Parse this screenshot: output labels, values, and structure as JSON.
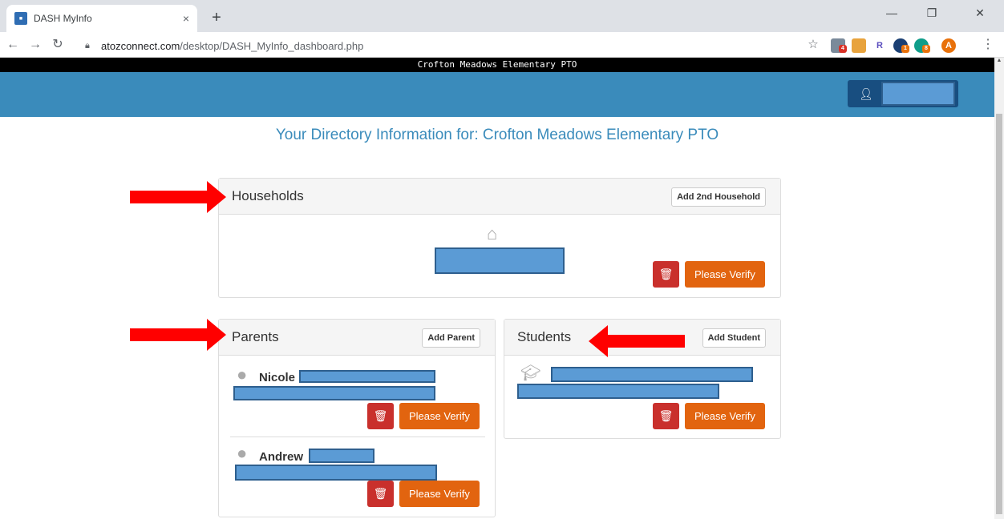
{
  "browser": {
    "tab_title": "DASH MyInfo",
    "tab_close": "×",
    "new_tab": "+",
    "url_host": "atozconnect.com",
    "url_path": "/desktop/DASH_MyInfo_dashboard.php",
    "ext_badges": [
      "4",
      "R",
      "1",
      "8",
      "A"
    ]
  },
  "site": {
    "banner": "Crofton Meadows Elementary PTO"
  },
  "page": {
    "title": "Your Directory Information for: Crofton Meadows Elementary PTO"
  },
  "households": {
    "heading": "Households",
    "add_label": "Add 2nd Household",
    "verify_label": "Please Verify"
  },
  "parents": {
    "heading": "Parents",
    "add_label": "Add  Parent",
    "items": [
      {
        "first_name": "Nicole",
        "verify_label": "Please Verify"
      },
      {
        "first_name": "Andrew",
        "verify_label": "Please Verify"
      }
    ]
  },
  "students": {
    "heading": "Students",
    "add_label": "Add Student",
    "verify_label": "Please Verify"
  },
  "colors": {
    "accent_blue": "#3a8bbb",
    "verify_orange": "#e2640f",
    "delete_red": "#c9302c",
    "annotation_red": "#ff0000"
  }
}
